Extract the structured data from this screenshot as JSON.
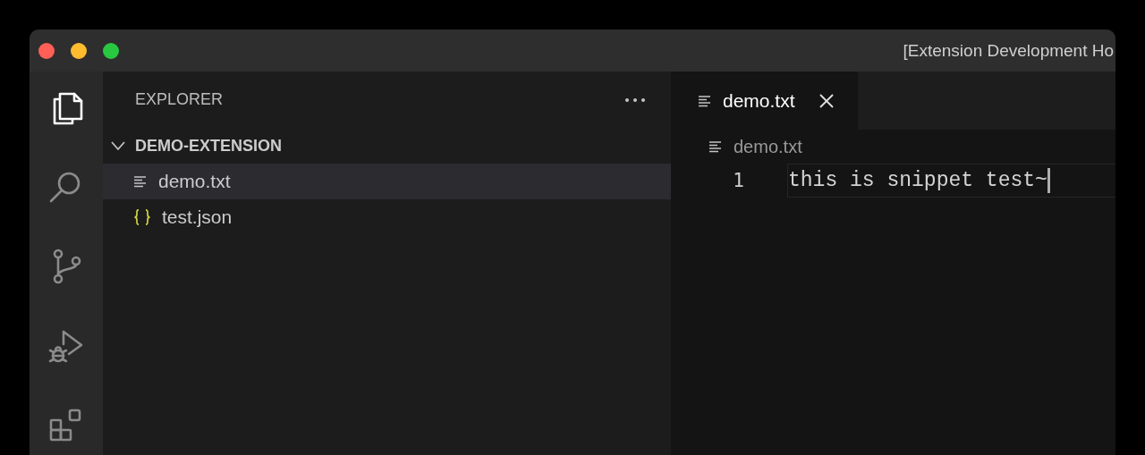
{
  "window": {
    "title": "[Extension Development Ho"
  },
  "activity_bar": [
    {
      "kind": "files",
      "selected": true
    },
    {
      "kind": "search",
      "selected": false
    },
    {
      "kind": "source-control",
      "selected": false
    },
    {
      "kind": "run-debug",
      "selected": false
    },
    {
      "kind": "extensions",
      "selected": false
    }
  ],
  "sidebar": {
    "title": "EXPLORER",
    "tree": [
      {
        "label": "DEMO-EXTENSION",
        "expanded": true,
        "children": [
          {
            "label": "demo.txt",
            "kind": "text",
            "selected": true
          },
          {
            "label": "test.json",
            "kind": "json",
            "selected": false
          }
        ]
      }
    ]
  },
  "editor": {
    "tabs": [
      {
        "label": "demo.txt",
        "kind": "text",
        "selected": true
      }
    ],
    "breadcrumb": {
      "label": "demo.txt",
      "kind": "text"
    },
    "lines": [
      {
        "number": "1",
        "text": "this is snippet test~"
      }
    ]
  }
}
